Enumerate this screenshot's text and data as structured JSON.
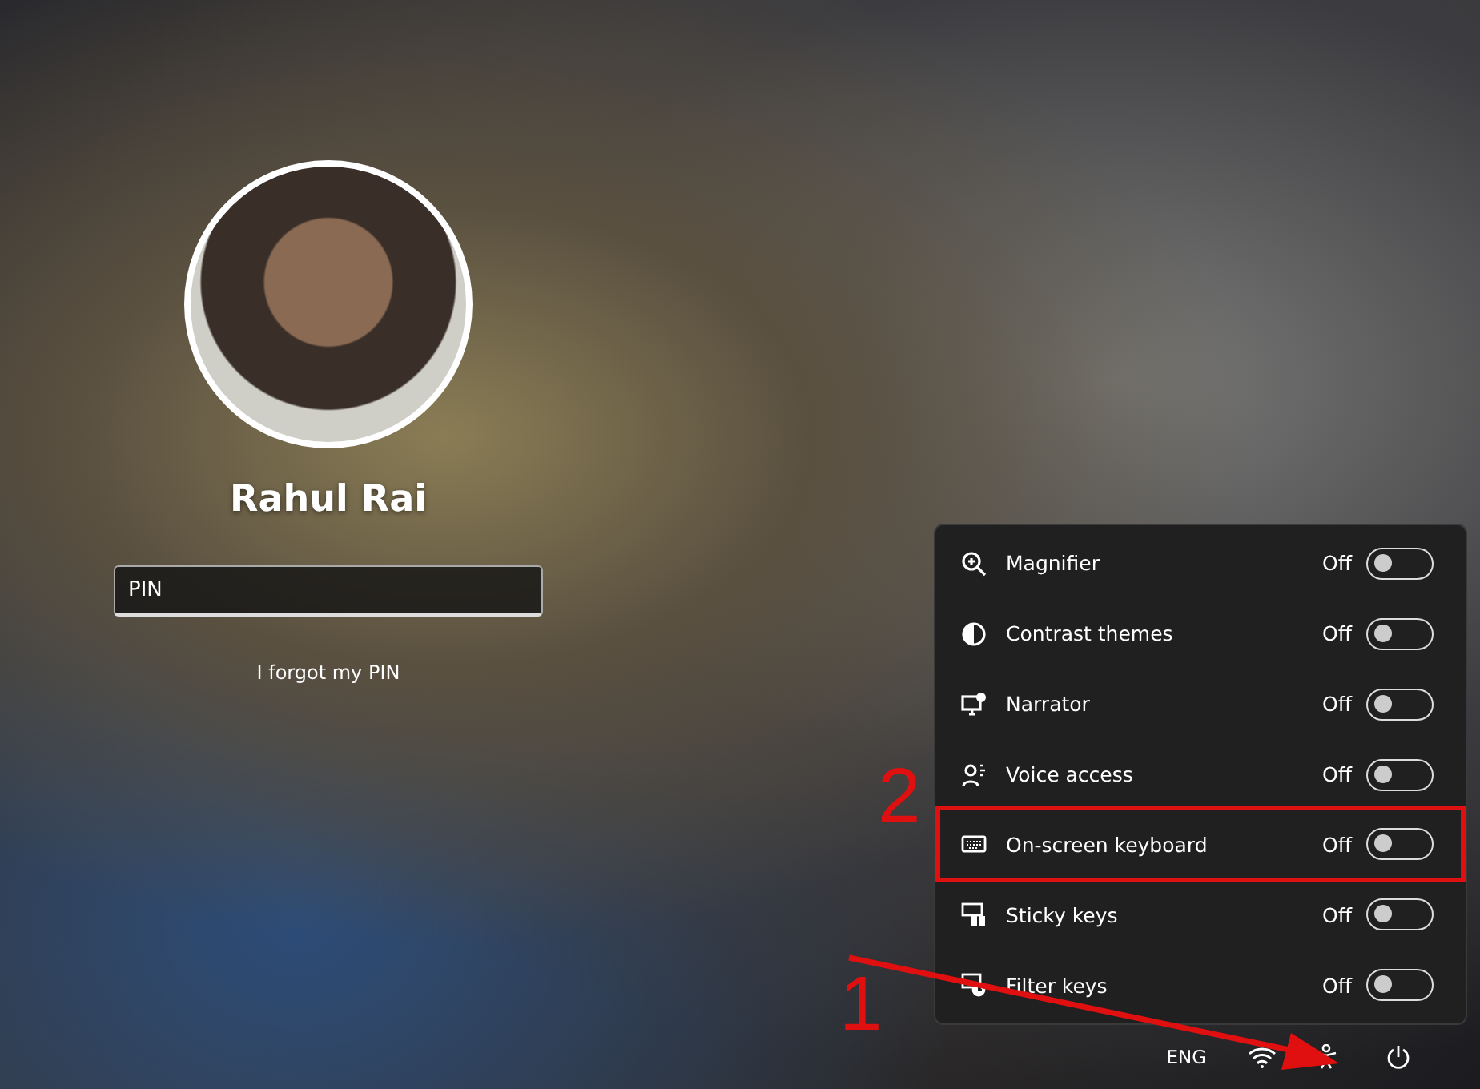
{
  "user": {
    "name": "Rahul Rai",
    "pin_field": {
      "placeholder": "PIN"
    },
    "forgot_link": "I forgot my PIN"
  },
  "accessibility_panel": {
    "items": [
      {
        "kind": "magnifier",
        "label": "Magnifier",
        "state": "Off",
        "on": false,
        "highlighted": false
      },
      {
        "kind": "contrast",
        "label": "Contrast themes",
        "state": "Off",
        "on": false,
        "highlighted": false
      },
      {
        "kind": "narrator",
        "label": "Narrator",
        "state": "Off",
        "on": false,
        "highlighted": false
      },
      {
        "kind": "voice",
        "label": "Voice access",
        "state": "Off",
        "on": false,
        "highlighted": false
      },
      {
        "kind": "keyboard",
        "label": "On-screen keyboard",
        "state": "Off",
        "on": false,
        "highlighted": true
      },
      {
        "kind": "sticky",
        "label": "Sticky keys",
        "state": "Off",
        "on": false,
        "highlighted": false
      },
      {
        "kind": "filter",
        "label": "Filter keys",
        "state": "Off",
        "on": false,
        "highlighted": false
      }
    ]
  },
  "status_bar": {
    "language": "ENG"
  },
  "annotations": [
    {
      "text": "2"
    },
    {
      "text": "1"
    }
  ]
}
